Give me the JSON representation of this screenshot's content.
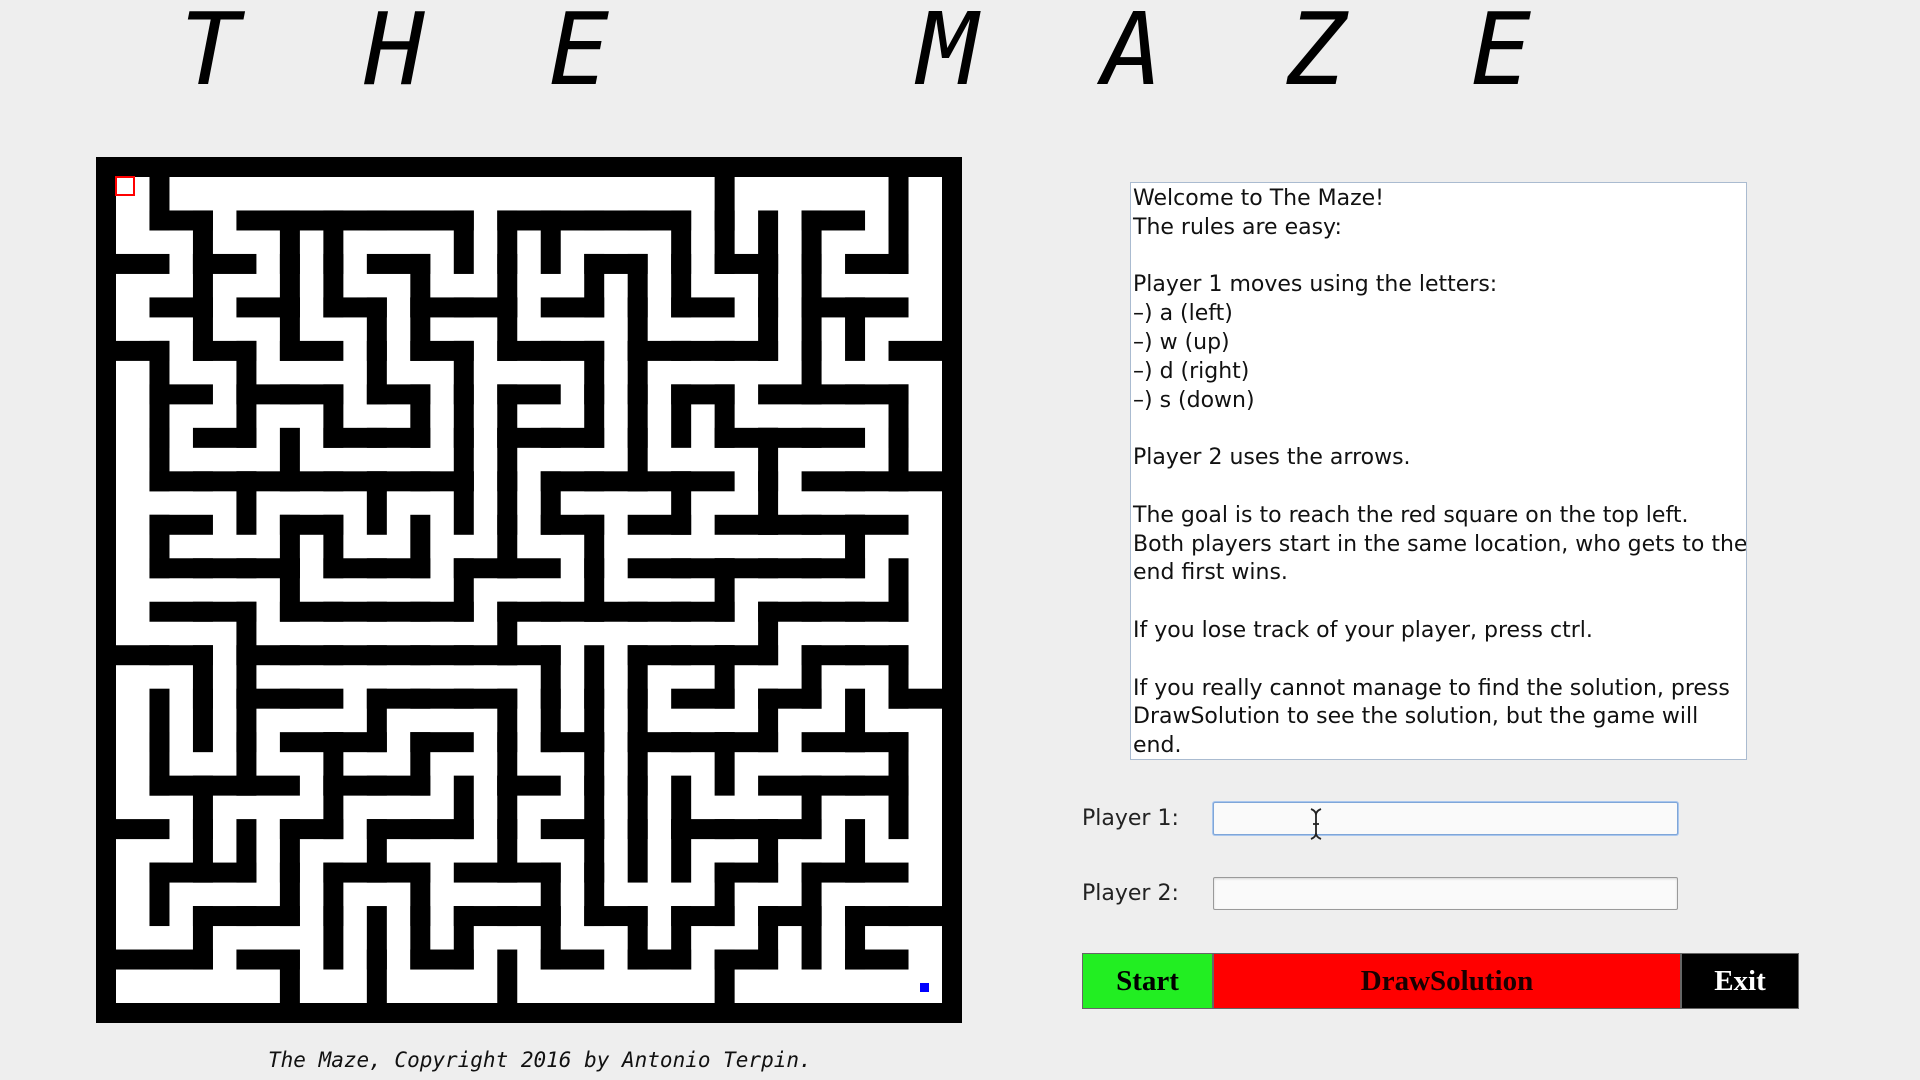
{
  "title": "T H E   M A Z E",
  "maze": {
    "wall_color": "#000000",
    "path_color": "#ffffff",
    "goal_marker_color": "#ff0000",
    "player_color": "#0000ff"
  },
  "rules_text": [
    "Welcome to The Maze!",
    "The rules are easy:",
    "",
    "Player 1 moves using the letters:",
    "–) a (left)",
    "–) w (up)",
    "–) d (right)",
    "–) s (down)",
    "",
    "Player 2 uses the arrows.",
    "",
    "The goal is to reach the red square on the top left.",
    "Both players start in the same location, who gets to the",
    "end first wins.",
    "",
    "If you lose track of your player, press ctrl.",
    "",
    "If you really cannot manage to find the solution, press",
    "DrawSolution to see the solution, but the game will",
    "end."
  ],
  "players": {
    "player1_label": "Player 1:",
    "player1_value": "",
    "player2_label": "Player 2:",
    "player2_value": ""
  },
  "buttons": {
    "start": "Start",
    "draw_solution": "DrawSolution",
    "exit": "Exit",
    "start_color": "#22ee22",
    "draw_solution_color": "#ff0000",
    "exit_color": "#000000"
  },
  "copyright": "The Maze, Copyright 2016 by Antonio Terpin."
}
